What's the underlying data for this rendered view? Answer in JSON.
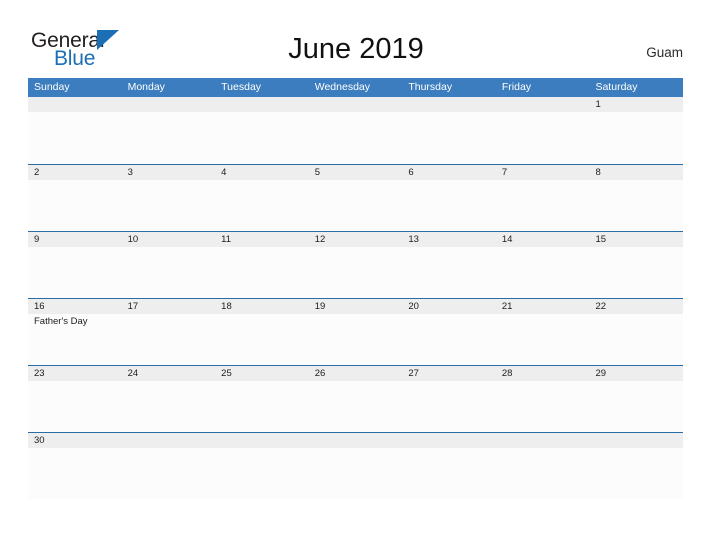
{
  "brand": {
    "name_part1": "General",
    "name_part2": "Blue",
    "triangle_color": "#1c6fb4",
    "text_color": "#231f20"
  },
  "header": {
    "title": "June 2019",
    "locale": "Guam"
  },
  "theme": {
    "header_blue": "#3b7dbe",
    "row_border_blue": "#2a6ca8",
    "day_band_gray": "#eeeeee",
    "cell_background": "#fcfcfd",
    "page_background": "#ffffff"
  },
  "calendar": {
    "month": "June",
    "year": "2019",
    "weekdays": [
      "Sunday",
      "Monday",
      "Tuesday",
      "Wednesday",
      "Thursday",
      "Friday",
      "Saturday"
    ],
    "weeks": [
      [
        {
          "day": ""
        },
        {
          "day": ""
        },
        {
          "day": ""
        },
        {
          "day": ""
        },
        {
          "day": ""
        },
        {
          "day": ""
        },
        {
          "day": "1"
        }
      ],
      [
        {
          "day": "2"
        },
        {
          "day": "3"
        },
        {
          "day": "4"
        },
        {
          "day": "5"
        },
        {
          "day": "6"
        },
        {
          "day": "7"
        },
        {
          "day": "8"
        }
      ],
      [
        {
          "day": "9"
        },
        {
          "day": "10"
        },
        {
          "day": "11"
        },
        {
          "day": "12"
        },
        {
          "day": "13"
        },
        {
          "day": "14"
        },
        {
          "day": "15"
        }
      ],
      [
        {
          "day": "16",
          "event": "Father's Day"
        },
        {
          "day": "17"
        },
        {
          "day": "18"
        },
        {
          "day": "19"
        },
        {
          "day": "20"
        },
        {
          "day": "21"
        },
        {
          "day": "22"
        }
      ],
      [
        {
          "day": "23"
        },
        {
          "day": "24"
        },
        {
          "day": "25"
        },
        {
          "day": "26"
        },
        {
          "day": "27"
        },
        {
          "day": "28"
        },
        {
          "day": "29"
        }
      ],
      [
        {
          "day": "30"
        },
        {
          "day": ""
        },
        {
          "day": ""
        },
        {
          "day": ""
        },
        {
          "day": ""
        },
        {
          "day": ""
        },
        {
          "day": ""
        }
      ]
    ]
  }
}
